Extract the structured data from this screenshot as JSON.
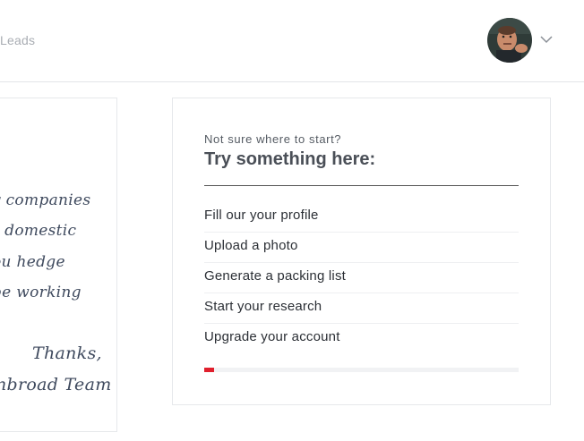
{
  "header": {
    "nav_leads": "Leads",
    "user_menu_icon": "chevron-down-icon"
  },
  "letter": {
    "lines": [
      "y companies",
      "r domestic",
      "ou hedge",
      "be working",
      "."
    ],
    "signoff_1": "Thanks,",
    "signoff_2": "nbroad Team"
  },
  "onboarding": {
    "eyebrow": "Not sure where to start?",
    "title": "Try something here:",
    "items": [
      "Fill our your profile",
      "Upload a photo",
      "Generate a packing list",
      "Start your research",
      "Upgrade your account"
    ],
    "progress_fraction": 0.03,
    "progress_color": "#e0202d"
  }
}
